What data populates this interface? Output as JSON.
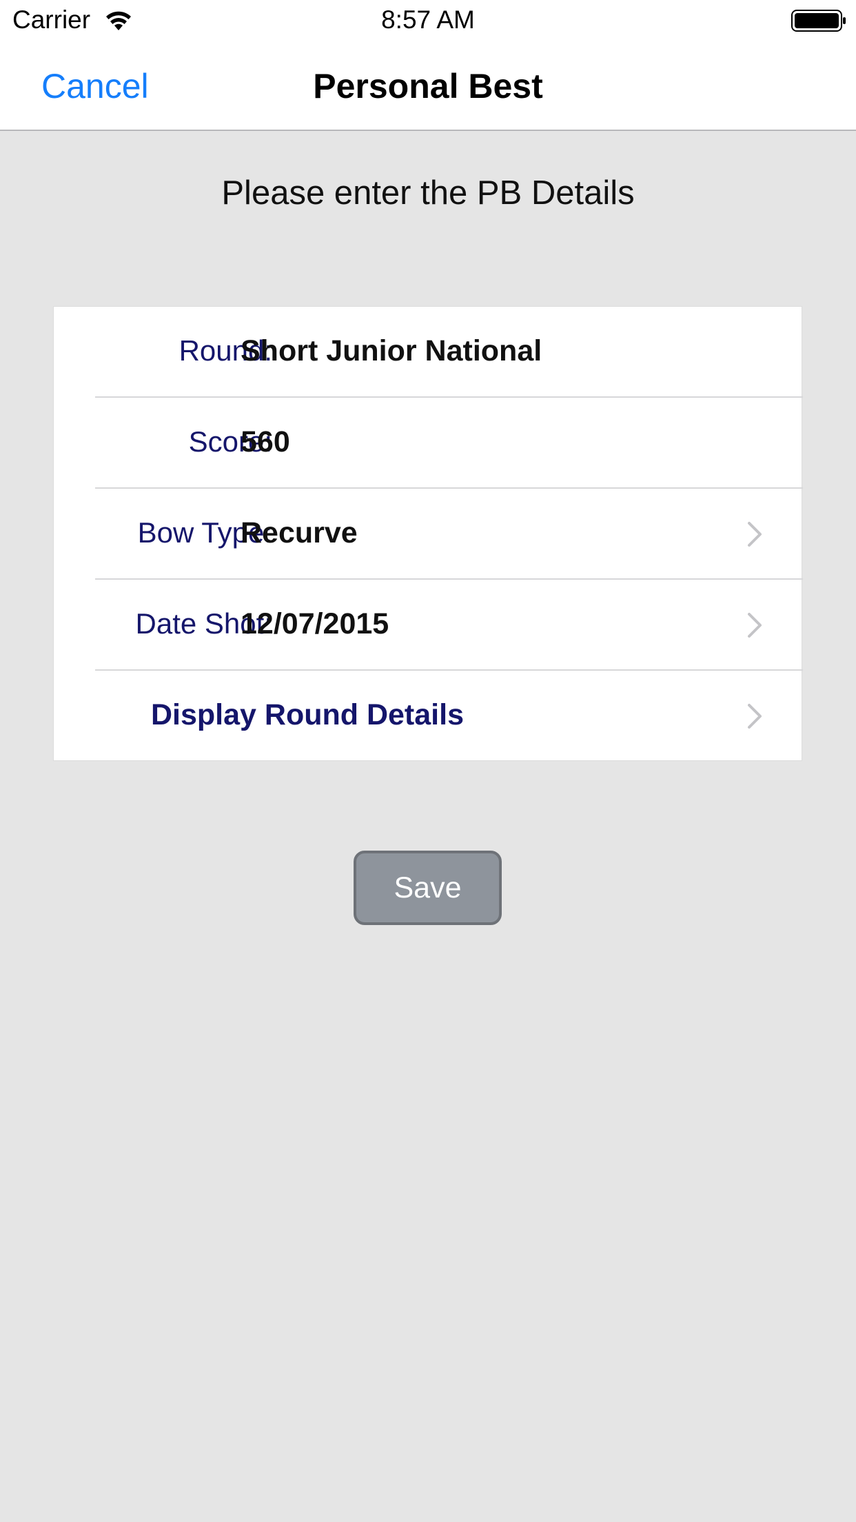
{
  "status_bar": {
    "carrier": "Carrier",
    "time": "8:57 AM",
    "icons": [
      "wifi-icon",
      "battery-icon"
    ]
  },
  "nav": {
    "cancel_label": "Cancel",
    "title": "Personal Best"
  },
  "instruction": "Please enter the PB Details",
  "form": {
    "rows": [
      {
        "label": "Round:",
        "value": "Short Junior National"
      },
      {
        "label": "Score:",
        "value": "560"
      },
      {
        "label": "Bow Type:",
        "value": "Recurve"
      },
      {
        "label": "Date Shot:",
        "value": "12/07/2015"
      }
    ],
    "details_link": "Display Round Details"
  },
  "save_label": "Save",
  "colors": {
    "accent": "#157efb",
    "label_navy": "#15166b",
    "background": "#e5e5e5",
    "button_gray": "#8e949c"
  }
}
